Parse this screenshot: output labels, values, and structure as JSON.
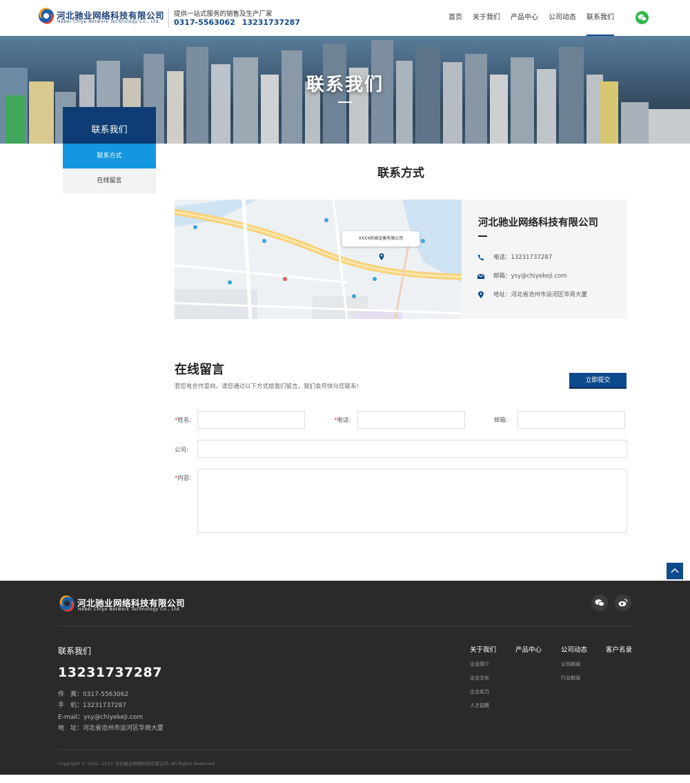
{
  "header": {
    "logo_cn": "河北驰业网络科技有限公司",
    "logo_en": "Hebei Chiye Network Technology Co., Ltd.",
    "slogan": "提供一站式服务的销售及生产厂家",
    "hotline_1": "0317-5563062",
    "hotline_2": "13231737287",
    "nav": [
      {
        "label": "首页"
      },
      {
        "label": "关于我们"
      },
      {
        "label": "产品中心"
      },
      {
        "label": "公司动态"
      },
      {
        "label": "联系我们"
      }
    ],
    "wechat_icon": "wechat-icon"
  },
  "banner": {
    "title": "联系我们"
  },
  "sidebar": {
    "title": "联系我们",
    "items": [
      {
        "label": "联系方式",
        "active": true
      },
      {
        "label": "在线留言",
        "active": false
      }
    ]
  },
  "contact": {
    "title": "联系方式",
    "map_label": "XXXX机械设备有限公司",
    "company": "河北驰业网络科技有限公司",
    "phone": "电话：13231737287",
    "email": "邮箱：ysy@chiyekeji.com",
    "address": "地址：河北省沧州市运河区华商大厦"
  },
  "message": {
    "title": "在线留言",
    "subtitle": "若您有合作意向，请您通过以下方式给我们留言，我们会尽快与您联系！",
    "submit_label": "立即提交",
    "name_label": "姓名:",
    "phone_label": "电话:",
    "email_label": "邮箱:",
    "company_label": "公司:",
    "content_label": "内容:",
    "required_mark": "*"
  },
  "footer": {
    "logo_cn": "河北驰业网络科技有限公司",
    "logo_en": "Hebei Chiye Network Technology Co., Ltd.",
    "contact_title": "联系我们",
    "phone": "13231737287",
    "fax": "传　真：0317-5563062",
    "mobile": "手　机：13231737287",
    "email": "E-mail：ysy@chiyekeji.com",
    "address": "地　址：河北省沧州市运河区华商大厦",
    "columns": [
      {
        "title": "关于我们",
        "links": [
          "企业简介",
          "企业文化",
          "企业实力",
          "人才招聘"
        ]
      },
      {
        "title": "产品中心",
        "links": []
      },
      {
        "title": "公司动态",
        "links": [
          "公司新闻",
          "行业新闻"
        ]
      },
      {
        "title": "客户名录",
        "links": []
      }
    ],
    "copyright": "Copyright © 2022- 2023 河北驰业网络科技有限公司, All Rights Reserved"
  },
  "colors": {
    "brand_dark": "#0d4a8c",
    "side_active": "#1497e0",
    "footer_bg": "#2a2a2a"
  }
}
